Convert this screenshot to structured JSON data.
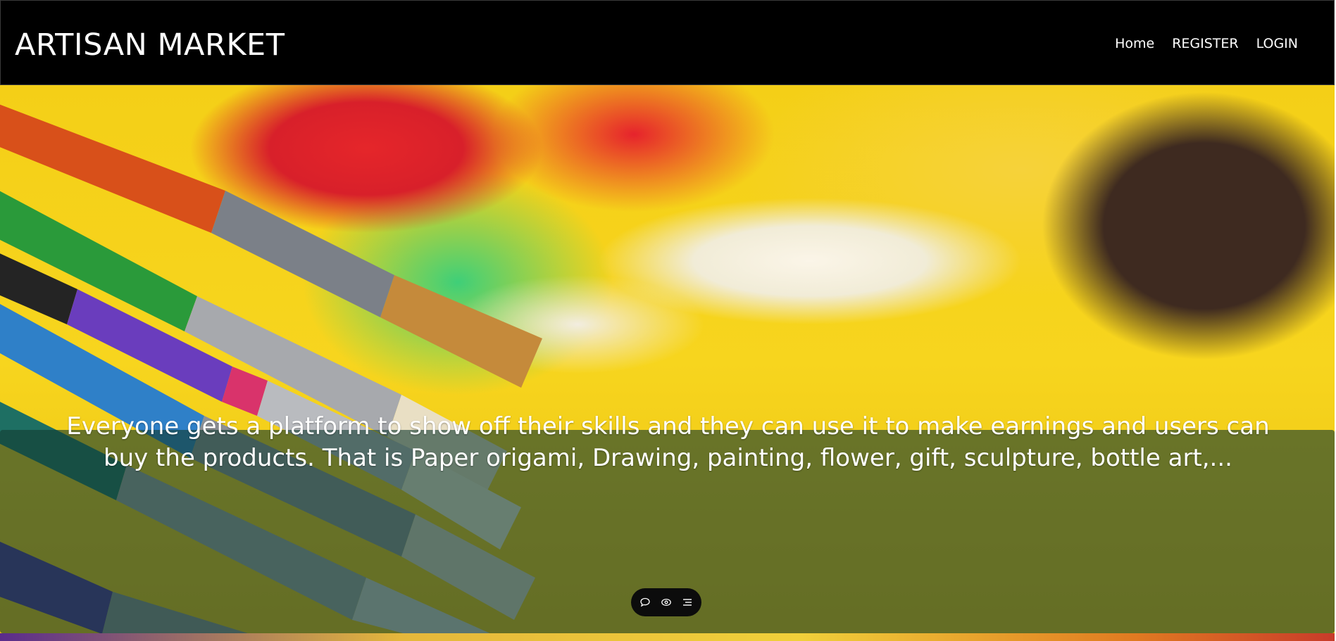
{
  "header": {
    "brand": "ARTISAN MARKET",
    "nav": [
      {
        "label": "Home"
      },
      {
        "label": "REGISTER"
      },
      {
        "label": "LOGIN"
      }
    ]
  },
  "hero": {
    "caption": "Everyone gets a platform to show off their skills and they can use it to make earnings and users can buy the products. That is Paper origami, Drawing, painting, flower, gift, sculpture, bottle art,...",
    "widget": {
      "icons": [
        "comment-icon",
        "eye-icon",
        "menu-lines-icon"
      ]
    }
  },
  "colors": {
    "navbar_bg": "#000000",
    "caption_overlay": "#143c32",
    "text": "#ffffff",
    "widget_bg": "#0c0c0c"
  }
}
